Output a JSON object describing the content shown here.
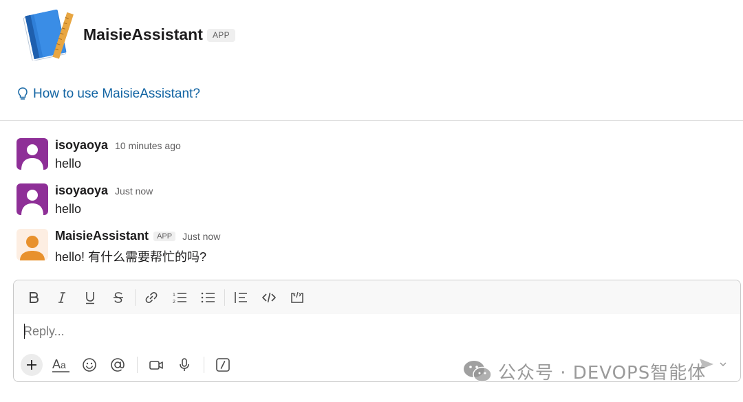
{
  "header": {
    "app_name": "MaisieAssistant",
    "app_badge": "APP",
    "how_to_link": "How to use MaisieAssistant?"
  },
  "messages": [
    {
      "sender": "isoyaoya",
      "time": "10 minutes ago",
      "text": "hello",
      "avatar": "user-avatar-purple"
    },
    {
      "sender": "isoyaoya",
      "time": "Just now",
      "text": "hello",
      "avatar": "user-avatar-purple"
    },
    {
      "sender": "MaisieAssistant",
      "badge": "APP",
      "time": "Just now",
      "text": "hello! 有什么需要帮忙的吗?",
      "avatar": "bot-avatar-orange"
    }
  ],
  "composer": {
    "placeholder": "Reply...",
    "format_tools": [
      "bold",
      "italic",
      "underline",
      "strikethrough",
      "link",
      "ordered-list",
      "bulleted-list",
      "blockquote",
      "code",
      "code-block"
    ],
    "bottom_tools": [
      "add",
      "formatting-toggle",
      "emoji",
      "mention",
      "video-clip",
      "audio-clip",
      "shortcuts"
    ]
  },
  "colors": {
    "link": "#1264a3",
    "avatar_purple": "#8e2f97",
    "avatar_orange_bg": "#fdeee2",
    "avatar_orange": "#e8912d",
    "logo_blue": "#2f7fd8"
  },
  "watermark": {
    "text": "公众号 · DEVOPS智能体"
  }
}
